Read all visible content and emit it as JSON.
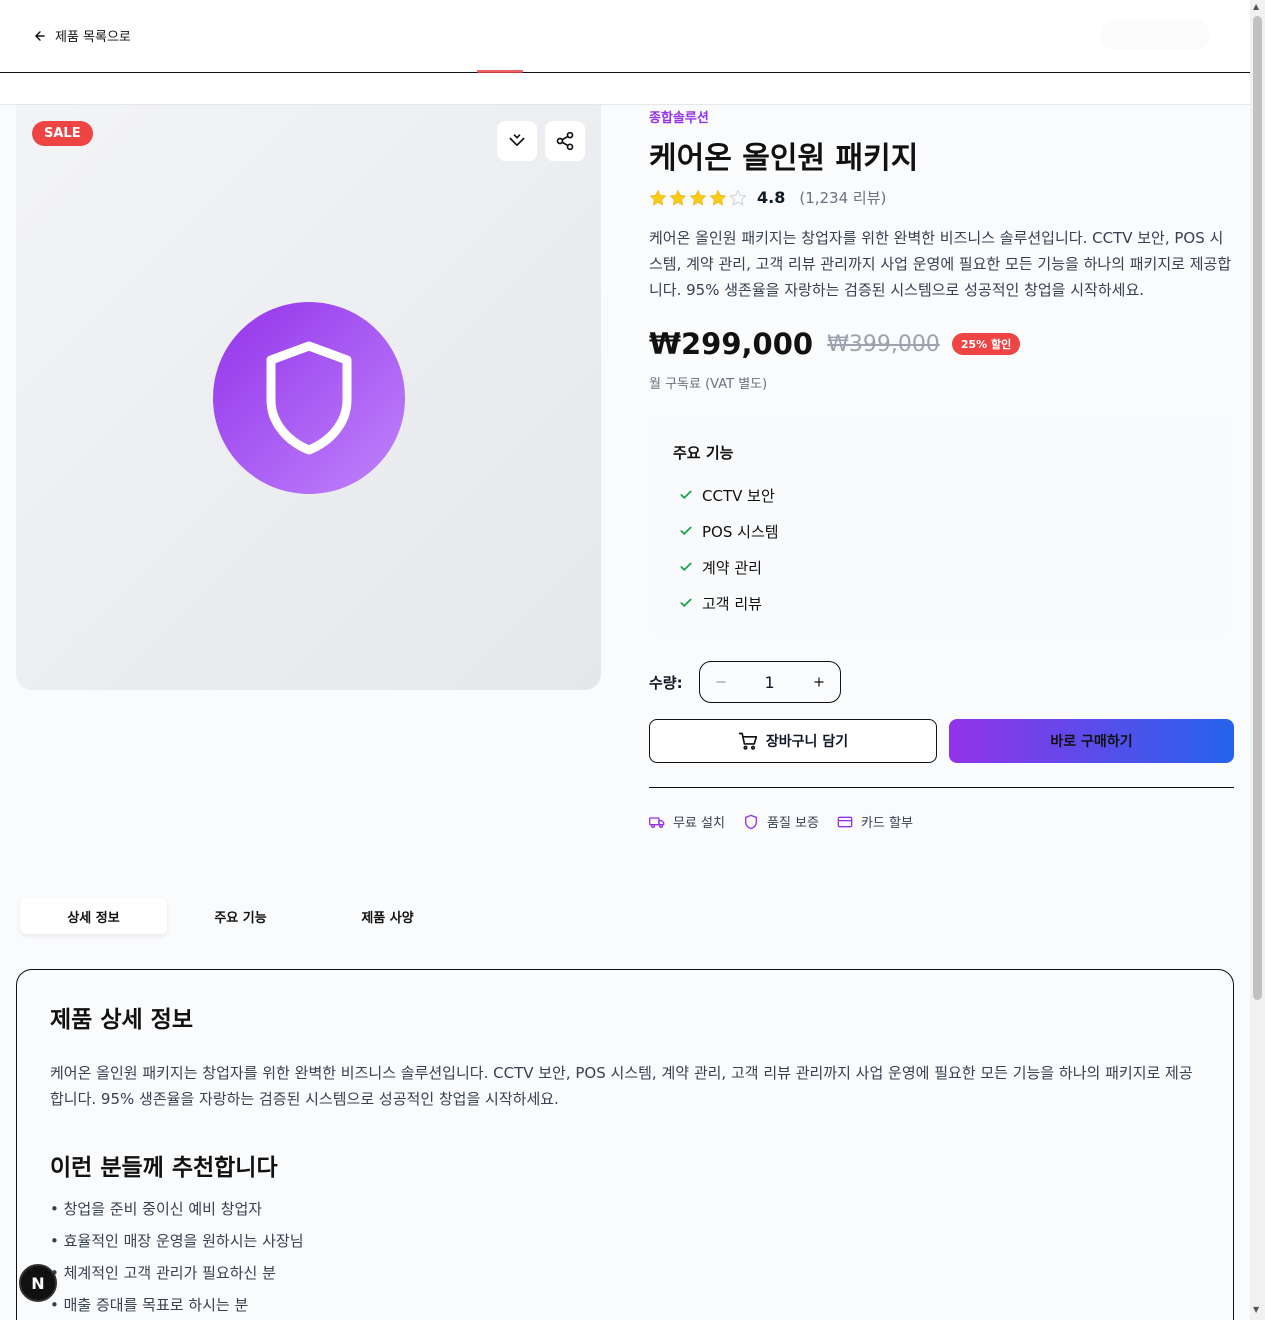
{
  "header": {
    "back_label": "제품 목록으로"
  },
  "image": {
    "sale_badge": "SALE"
  },
  "product": {
    "category": "종합솔루션",
    "title": "케어온 올인원 패키지",
    "rating": "4.8",
    "rating_stars": 4,
    "review_count": "(1,234 리뷰)",
    "description": "케어온 올인원 패키지는 창업자를 위한 완벽한 비즈니스 솔루션입니다. CCTV 보안, POS 시스템, 계약 관리, 고객 리뷰 관리까지 사업 운영에 필요한 모든 기능을 하나의 패키지로 제공합니다. 95% 생존율을 자랑하는 검증된 시스템으로 성공적인 창업을 시작하세요.",
    "price": "₩299,000",
    "original_price": "₩399,000",
    "discount": "25% 할인",
    "price_note": "월 구독료 (VAT 별도)"
  },
  "features": {
    "title": "주요 기능",
    "items": [
      "CCTV 보안",
      "POS 시스템",
      "계약 관리",
      "고객 리뷰"
    ]
  },
  "quantity": {
    "label": "수량:",
    "value": "1"
  },
  "actions": {
    "cart_label": "장바구니 담기",
    "buy_label": "바로 구매하기"
  },
  "perks": [
    "무료 설치",
    "품질 보증",
    "카드 할부"
  ],
  "tabs": [
    "상세 정보",
    "주요 기능",
    "제품 사양"
  ],
  "detail": {
    "heading": "제품 상세 정보",
    "body": "케어온 올인원 패키지는 창업자를 위한 완벽한 비즈니스 솔루션입니다. CCTV 보안, POS 시스템, 계약 관리, 고객 리뷰 관리까지 사업 운영에 필요한 모든 기능을 하나의 패키지로 제공합니다. 95% 생존율을 자랑하는 검증된 시스템으로 성공적인 창업을 시작하세요.",
    "rec_heading": "이런 분들께 추천합니다",
    "rec_items": [
      "• 창업을 준비 중이신 예비 창업자",
      "• 효율적인 매장 운영을 원하시는 사장님",
      "• 체계적인 고객 관리가 필요하신 분",
      "• 매출 증대를 목표로 하시는 분"
    ]
  },
  "dev_badge": "N",
  "colors": {
    "accent": "#9333ea",
    "sale": "#ef4444",
    "check": "#16a34a",
    "star": "#facc15"
  }
}
